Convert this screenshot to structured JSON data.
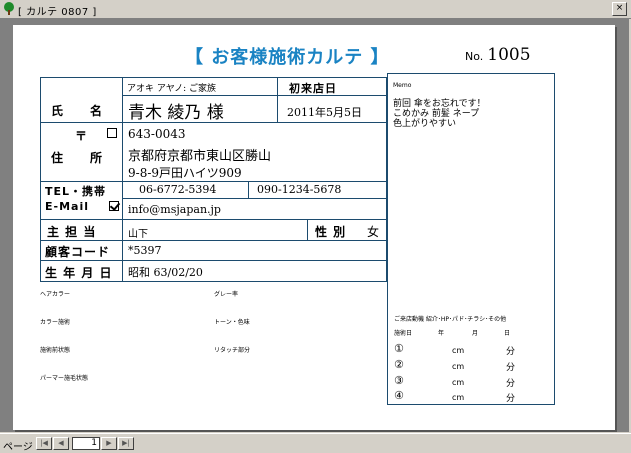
{
  "window": {
    "title": "[ カルテ  0807 ]",
    "close_label": "×"
  },
  "statusbar": {
    "page_label": "ページ",
    "page_number": "1",
    "first": "|◀",
    "prev": "◀",
    "next": "▶",
    "last": "▶|"
  },
  "card": {
    "heading": "【  お客様施術カルテ  】",
    "no_label": "No.",
    "no_value": "1005",
    "furigana": "アオキ アヤノ: ご家族",
    "first_visit_label": "初来店日",
    "first_visit_date": "2011年5月5日",
    "name_label": "氏　　名",
    "name_value": "青木  綾乃  様",
    "postal_mark": "〒",
    "postal_code": "643-0043",
    "address_label": "住　　所",
    "address_line1": "京都府京都市東山区勝山",
    "address_line2": "9-8-9戸田ハイツ909",
    "tel_label": "TEL・携帯",
    "tel_value": "06-6772-5394",
    "mobile_value": "090-1234-5678",
    "email_label": "E-Mail",
    "email_value": "info@msjapan.jp",
    "staff_label": "主  担  当",
    "staff_value": "山下",
    "gender_label": "性 別",
    "gender_value": "女",
    "code_label": "顧客コード",
    "code_value": "*5397",
    "birth_label": "生 年 月 日",
    "birth_value": "昭和  63/02/20"
  },
  "notes": {
    "hair_color": "ヘアカラー",
    "gray_hair": "グレー率",
    "color_treatment": "カラー施術",
    "tone": "トーン・色味",
    "pre_condition": "施術前状態",
    "retouch": "リタッチ部分",
    "perm": "パーマー施毛状態"
  },
  "memo": {
    "label": "Memo",
    "line1": "前回  傘をお忘れです！",
    "line2": "こめかみ  前髪  ネープ",
    "line3": "色上がりやすい",
    "motive_label": "ご来店動機  紹介･HP･パド･チラシ･その他",
    "col_date": "施術日",
    "col_year": "年",
    "col_month": "月",
    "col_day": "日",
    "rows": [
      {
        "mark": "①",
        "unit1": "cm",
        "unit2": "分"
      },
      {
        "mark": "②",
        "unit1": "cm",
        "unit2": "分"
      },
      {
        "mark": "③",
        "unit1": "cm",
        "unit2": "分"
      },
      {
        "mark": "④",
        "unit1": "cm",
        "unit2": "分"
      }
    ]
  },
  "colors": {
    "accent": "#1a83c3",
    "border": "#1c4b6e"
  }
}
